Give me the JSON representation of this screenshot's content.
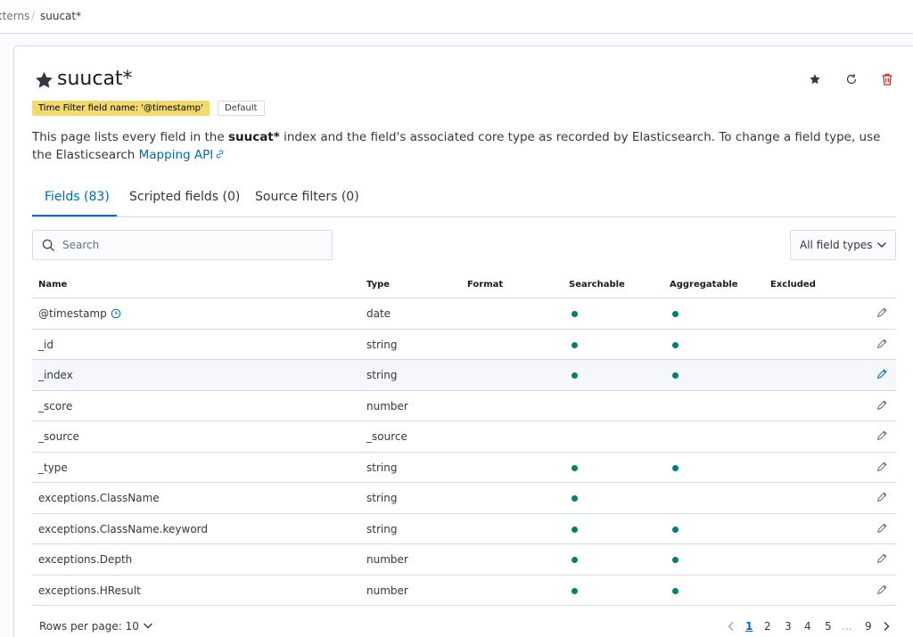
{
  "breadcrumb": {
    "previous": "tterns",
    "separator": "/",
    "current": "suucat*"
  },
  "page": {
    "title": "suucat*",
    "badges": {
      "time_filter": "Time Filter field name: '@timestamp'",
      "default": "Default"
    },
    "description": {
      "part1": "This page lists every field in the ",
      "index_name": "suucat*",
      "part2": " index and the field's associated core type as recorded by Elasticsearch. To change a field type, use the Elasticsearch ",
      "link": "Mapping API"
    },
    "header_icons": [
      "star-icon",
      "refresh-icon",
      "delete-icon"
    ]
  },
  "tabs": [
    {
      "label": "Fields (83)",
      "active": true
    },
    {
      "label": "Scripted fields (0)",
      "active": false
    },
    {
      "label": "Source filters (0)",
      "active": false
    }
  ],
  "search": {
    "placeholder": "Search",
    "value": ""
  },
  "filter": {
    "label": "All field types"
  },
  "table": {
    "columns": [
      "Name",
      "Type",
      "Format",
      "Searchable",
      "Aggregatable",
      "Excluded"
    ],
    "rows": [
      {
        "name": "@timestamp",
        "time_field": true,
        "type": "date",
        "format": "",
        "searchable": true,
        "aggregatable": true,
        "excluded": false
      },
      {
        "name": "_id",
        "type": "string",
        "format": "",
        "searchable": true,
        "aggregatable": true,
        "excluded": false
      },
      {
        "name": "_index",
        "type": "string",
        "format": "",
        "searchable": true,
        "aggregatable": true,
        "excluded": false,
        "hovered": true
      },
      {
        "name": "_score",
        "type": "number",
        "format": "",
        "searchable": false,
        "aggregatable": false,
        "excluded": false
      },
      {
        "name": "_source",
        "type": "_source",
        "format": "",
        "searchable": false,
        "aggregatable": false,
        "excluded": false
      },
      {
        "name": "_type",
        "type": "string",
        "format": "",
        "searchable": true,
        "aggregatable": true,
        "excluded": false
      },
      {
        "name": "exceptions.ClassName",
        "type": "string",
        "format": "",
        "searchable": true,
        "aggregatable": false,
        "excluded": false
      },
      {
        "name": "exceptions.ClassName.keyword",
        "type": "string",
        "format": "",
        "searchable": true,
        "aggregatable": true,
        "excluded": false
      },
      {
        "name": "exceptions.Depth",
        "type": "number",
        "format": "",
        "searchable": true,
        "aggregatable": true,
        "excluded": false
      },
      {
        "name": "exceptions.HResult",
        "type": "number",
        "format": "",
        "searchable": true,
        "aggregatable": true,
        "excluded": false
      }
    ]
  },
  "pagination": {
    "rows_per_page": "Rows per page: 10",
    "pages": [
      "1",
      "2",
      "3",
      "4",
      "5",
      "...",
      "9"
    ],
    "current_page": "1"
  },
  "colors": {
    "accent": "#006bb4",
    "dot": "#017d73",
    "time_badge": "#f1d86f",
    "delete": "#bd271e"
  }
}
